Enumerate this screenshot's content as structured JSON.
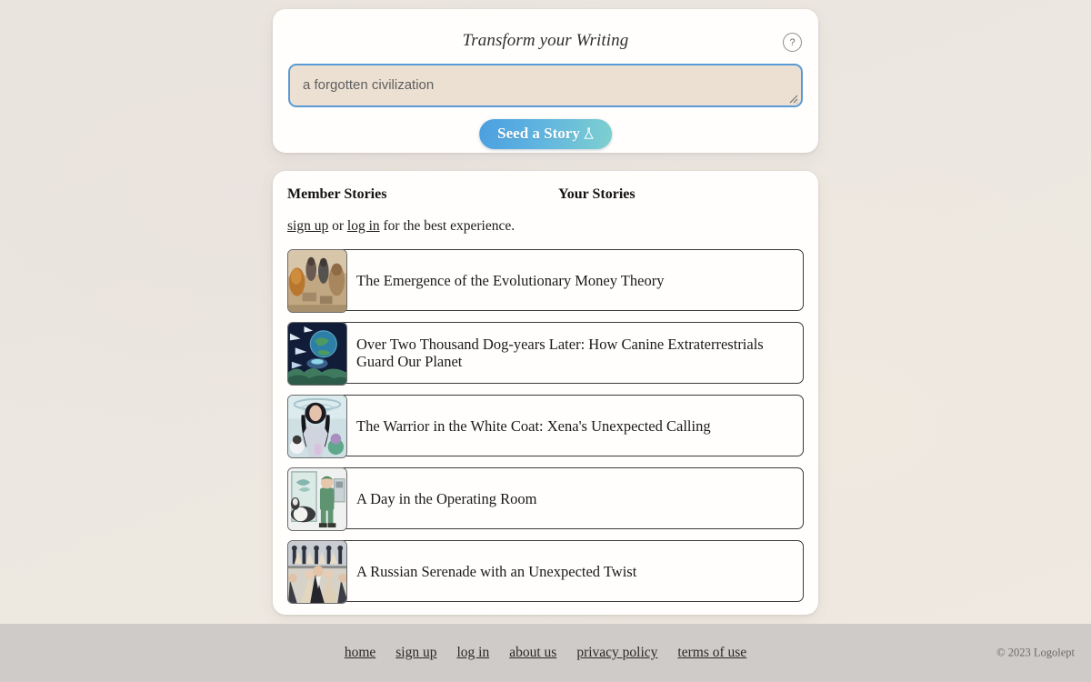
{
  "seed_panel": {
    "title": "Transform your Writing",
    "help_icon_label": "?",
    "prompt_value": "a forgotten civilization",
    "prompt_placeholder": "a forgotten civilization",
    "submit_label": "Seed a Story"
  },
  "stories_panel": {
    "tab_member": "Member Stories",
    "tab_mine": "Your Stories",
    "auth_signup": "sign up",
    "auth_or": " or ",
    "auth_login": "log in",
    "auth_tail": " for the best experience.",
    "stories": [
      {
        "title": "The Emergence of the Evolutionary Money Theory",
        "thumb": "ancient-marketplace"
      },
      {
        "title": "Over Two Thousand Dog-years Later: How Canine Extraterrestrials Guard Our Planet",
        "thumb": "earth-from-space"
      },
      {
        "title": "The Warrior in the White Coat: Xena's Unexpected Calling",
        "thumb": "woman-surgeon"
      },
      {
        "title": "A Day in the Operating Room",
        "thumb": "vet-with-dog"
      },
      {
        "title": "A Russian Serenade with an Unexpected Twist",
        "thumb": "ballroom-dancers"
      }
    ]
  },
  "footer": {
    "links": [
      "home",
      "sign up",
      "log in",
      "about us",
      "privacy policy",
      "terms of use"
    ],
    "copyright": "© 2023 Logolept"
  },
  "colors": {
    "page_background": "#ece7e0",
    "card_background": "#fffefc",
    "footer_background": "#cfcbc8",
    "input_border": "#5b9bd5",
    "input_fill": "#ece0d2",
    "button_gradient_start": "#4b9fe0",
    "button_gradient_end": "#7fd0cf"
  }
}
